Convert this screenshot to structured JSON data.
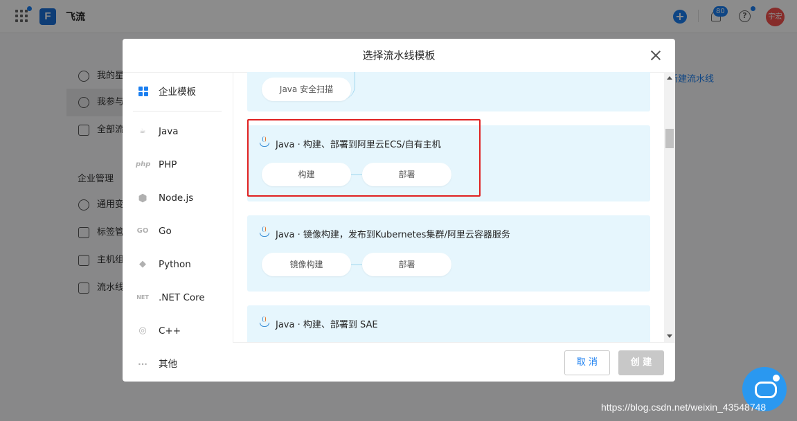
{
  "app": {
    "name": "飞流",
    "logo_letter": "F"
  },
  "topbar": {
    "notification_count": "80",
    "help_glyph": "?",
    "avatar_text": "宇宏"
  },
  "sidebar": {
    "items": [
      {
        "label": "我的星",
        "icon": "star-icon"
      },
      {
        "label": "我参与",
        "icon": "user-icon"
      },
      {
        "label": "全部流",
        "icon": "swap-icon"
      }
    ],
    "group_title": "企业管理",
    "group_items": [
      {
        "label": "通用变",
        "icon": "share-icon"
      },
      {
        "label": "标签管",
        "icon": "tag-icon"
      },
      {
        "label": "主机组",
        "icon": "server-icon"
      },
      {
        "label": "流水线",
        "icon": "box-icon"
      }
    ]
  },
  "background": {
    "new_pipeline": "新建流水线"
  },
  "dialog": {
    "title": "选择流水线模板",
    "categories": [
      {
        "label": "企业模板",
        "icon": "grid-icon",
        "glyph": ""
      },
      {
        "label": "Java",
        "icon": "java-icon",
        "glyph": ""
      },
      {
        "label": "PHP",
        "icon": "php-icon",
        "glyph": "php"
      },
      {
        "label": "Node.js",
        "icon": "nodejs-icon",
        "glyph": "⬢"
      },
      {
        "label": "Go",
        "icon": "go-icon",
        "glyph": "GO"
      },
      {
        "label": "Python",
        "icon": "python-icon",
        "glyph": "◆"
      },
      {
        "label": ".NET Core",
        "icon": "dotnet-icon",
        "glyph": "NET"
      },
      {
        "label": "C++",
        "icon": "cpp-icon",
        "glyph": "◎"
      },
      {
        "label": "其他",
        "icon": "more-icon",
        "glyph": "···"
      }
    ],
    "templates": [
      {
        "title": "",
        "stages": [
          "Java 安全扫描"
        ]
      },
      {
        "title": "Java · 构建、部署到阿里云ECS/自有主机",
        "stages": [
          "构建",
          "部署"
        ]
      },
      {
        "title": "Java · 镜像构建，发布到Kubernetes集群/阿里云容器服务",
        "stages": [
          "镜像构建",
          "部署"
        ]
      },
      {
        "title": "Java · 构建、部署到 SAE",
        "stages": []
      }
    ],
    "cancel_label": "取 消",
    "create_label": "创 建"
  },
  "watermark": "https://blog.csdn.net/weixin_43548748",
  "colors": {
    "accent": "#1b7ff0",
    "highlight_border": "#e02020",
    "template_bg": "#e6f6fd"
  }
}
